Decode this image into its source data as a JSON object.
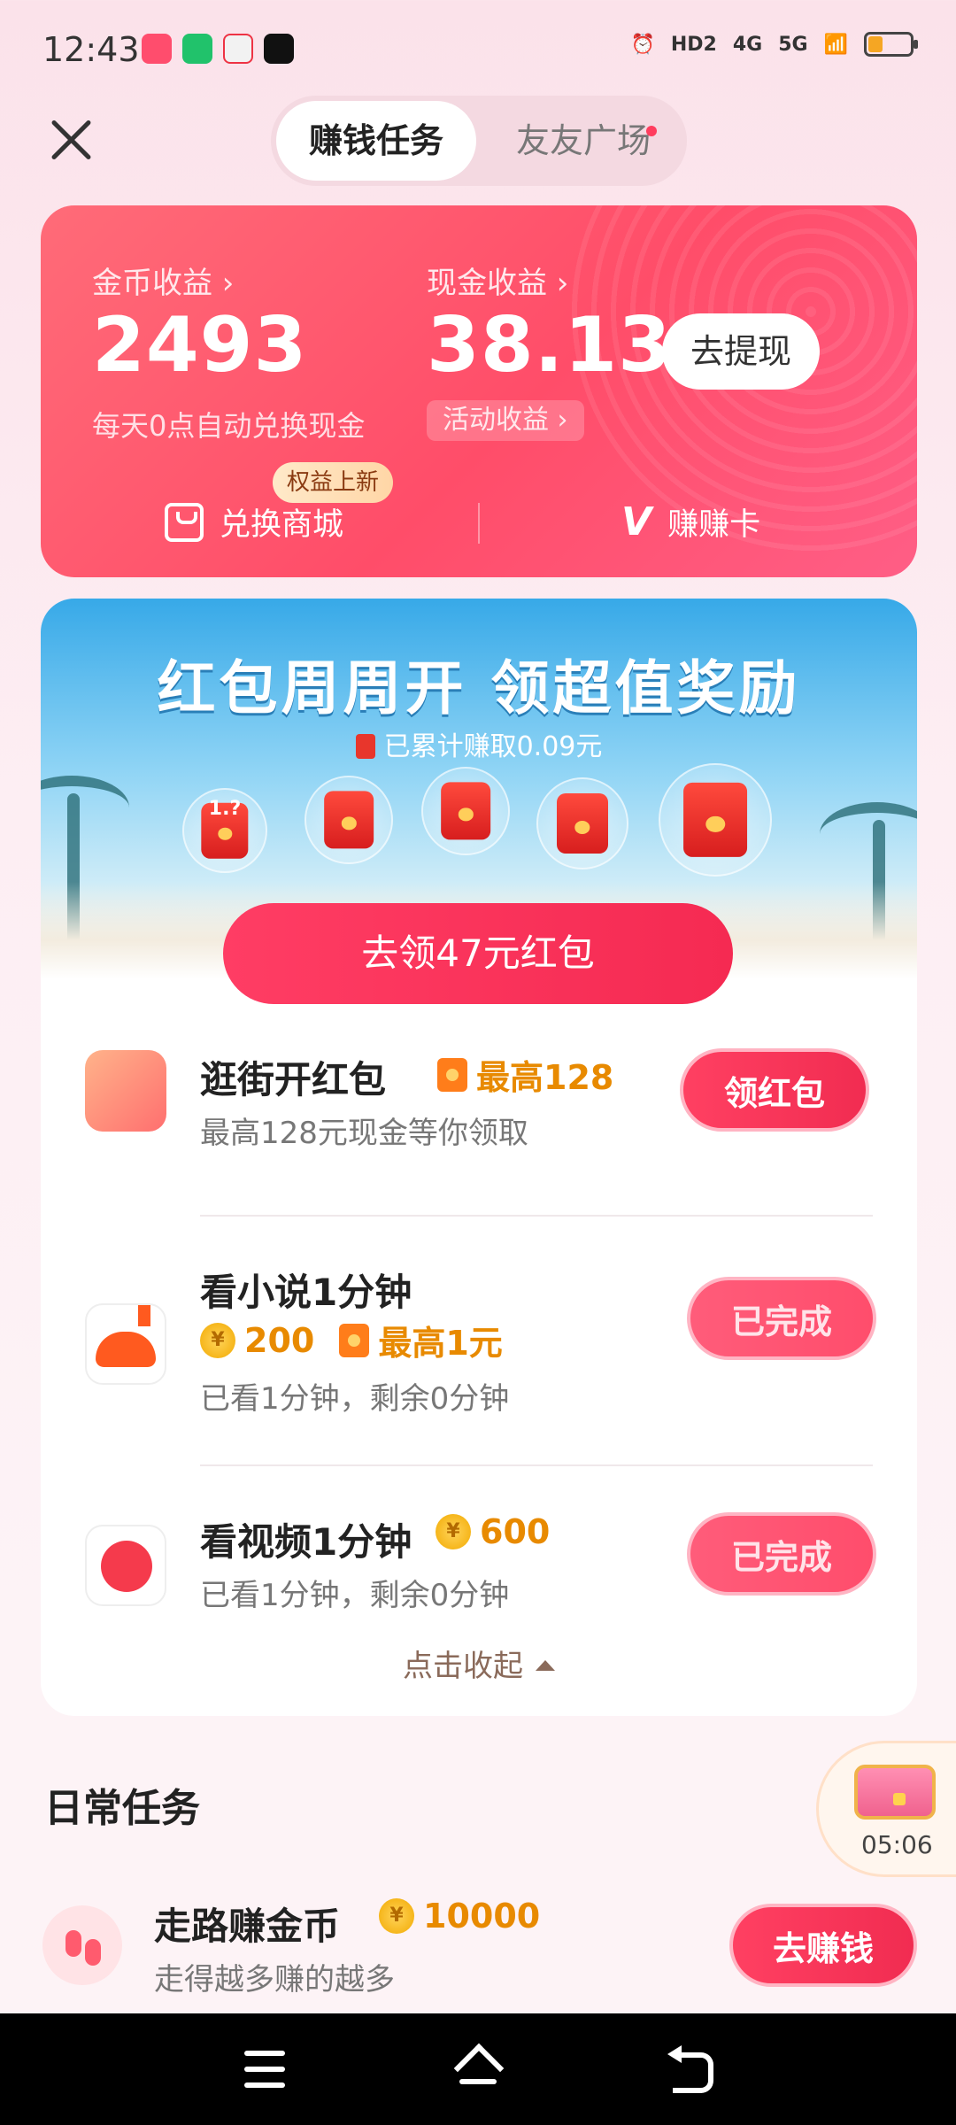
{
  "status_bar": {
    "time": "12:43",
    "network_icons": [
      "HD2",
      "4G",
      "5G"
    ],
    "battery_level": 0.35,
    "battery_color": "#f5a623"
  },
  "header": {
    "tabs": [
      {
        "label": "赚钱任务",
        "active": true
      },
      {
        "label": "友友广场",
        "active": false,
        "has_dot": true
      }
    ]
  },
  "earnings": {
    "coin_label": "金币收益 ›",
    "coin_value": "2493",
    "coin_sub": "每天0点自动兑换现金",
    "cash_label": "现金收益 ›",
    "cash_value": "38.13",
    "activity_pill": "活动收益 ›",
    "withdraw_button": "去提现",
    "new_badge": "权益上新",
    "shop_link": "兑换商城",
    "card_link": "赚赚卡"
  },
  "banner": {
    "title": "红包周周开 领超值奖励",
    "subtitle": "已累计赚取0.09元",
    "first_packet_label": "1.?",
    "claim_button": "去领47元红包"
  },
  "tasks": [
    {
      "title": "逛街开红包",
      "reward": "最高128",
      "desc": "最高128元现金等你领取",
      "button": "领红包"
    },
    {
      "title": "看小说1分钟",
      "coin_reward": "200",
      "cash_reward": "最高1元",
      "desc": "已看1分钟，剩余0分钟",
      "button": "已完成"
    },
    {
      "title": "看视频1分钟",
      "coin_reward": "600",
      "desc": "已看1分钟，剩余0分钟",
      "button": "已完成"
    }
  ],
  "collapse_label": "点击收起",
  "daily": {
    "section_title": "日常任务",
    "title": "走路赚金币",
    "coin_reward": "10000",
    "desc": "走得越多赚的越多",
    "button": "去赚钱"
  },
  "floating_chest": {
    "timer": "05:06"
  },
  "colors": {
    "accent": "#ff4d69",
    "reward": "#e88a00"
  }
}
